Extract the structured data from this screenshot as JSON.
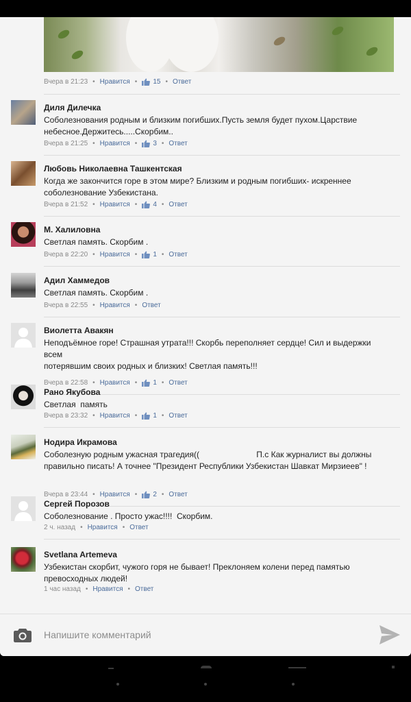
{
  "post": {
    "time": "Вчера в 21:23",
    "like_label": "Нравится",
    "like_count": "15",
    "reply_label": "Ответ"
  },
  "comments": [
    {
      "author": "Диля Дилечка",
      "text": "Соболезнования родным и близким погибших.Пусть земля будет пухом.Царствие\nнебесное.Держитесь.....Скорбим..",
      "time": "Вчера в 21:25",
      "like_label": "Нравится",
      "like_count": "3",
      "reply_label": "Ответ"
    },
    {
      "author": "Любовь Николаевна Ташкентская",
      "text": "Когда же закончится горе в этом мире? Близким и родным погибших- искреннее\nсоболезнование Узбекистана.",
      "time": "Вчера в 21:52",
      "like_label": "Нравится",
      "like_count": "4",
      "reply_label": "Ответ"
    },
    {
      "author": "М. Халиловна",
      "text": "Светлая память. Скорбим .",
      "time": "Вчера в 22:20",
      "like_label": "Нравится",
      "like_count": "1",
      "reply_label": "Ответ"
    },
    {
      "author": "Адил Хаммедов",
      "text": "Светлая память. Скорбим .",
      "time": "Вчера в 22:55",
      "like_label": "Нравится",
      "like_count": "",
      "reply_label": "Ответ"
    },
    {
      "author": "Виолетта Авакян",
      "text": "Неподъёмное горе! Страшная утрата!!! Скорбь переполняет сердце! Сил и выдержки всем\nпотерявшим своих родных и близких! Светлая память!!!",
      "time": "Вчера в 22:58",
      "like_label": "Нравится",
      "like_count": "1",
      "reply_label": "Ответ"
    },
    {
      "author": "Рано Якубова",
      "text": "Светлая  память",
      "time": "Вчера в 23:32",
      "like_label": "Нравится",
      "like_count": "1",
      "reply_label": "Ответ"
    },
    {
      "author": "Нодира Икрамова",
      "text": "Соболезную родным ужасная трагедия((                         П.с Как журналист вы должны\nправильно писать! А точнее \"Президент Республики Узбекистан Шавкат Мирзиеев\" !",
      "time": "Вчера в 23:44",
      "like_label": "Нравится",
      "like_count": "2",
      "reply_label": "Ответ"
    },
    {
      "author": "Сергей Порозов",
      "text": "Соболезнование . Просто ужас!!!!  Скорбим.",
      "time": "2 ч. назад",
      "like_label": "Нравится",
      "like_count": "",
      "reply_label": "Ответ"
    },
    {
      "author": "Svetlana Artemeva",
      "text": "Узбекистан скорбит, чужого горя не бывает! Преклоняем колени перед памятью\nпревосходных людей!",
      "time": "1 час назад",
      "like_label": "Нравится",
      "like_count": "",
      "reply_label": "Ответ"
    }
  ],
  "composer": {
    "placeholder": "Напишите комментарий",
    "camera_icon": "camera-icon",
    "send_icon": "send-icon"
  },
  "colors": {
    "link": "#4a6b9a",
    "meta_text": "#8a8a8a",
    "background": "#f4f4f4"
  }
}
